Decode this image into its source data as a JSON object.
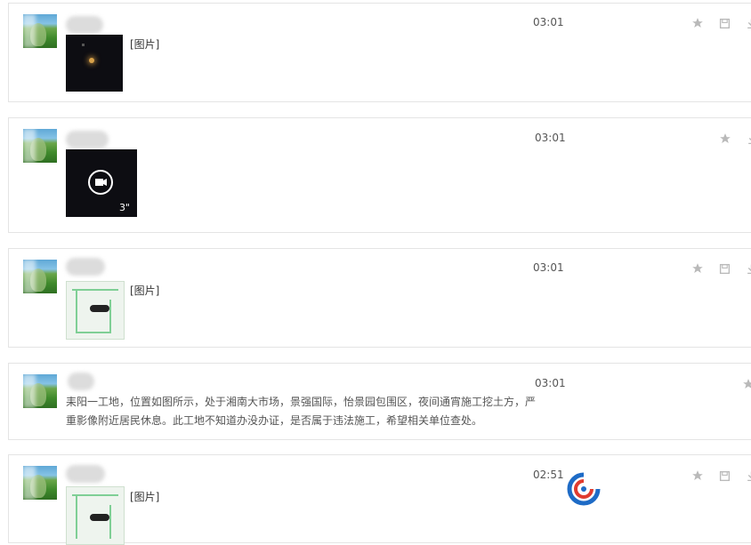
{
  "messages": [
    {
      "type": "image",
      "time": "03:01",
      "pic_label": "[图片]"
    },
    {
      "type": "video",
      "time": "03:01",
      "duration": "3\""
    },
    {
      "type": "image",
      "time": "03:01",
      "pic_label": "[图片]"
    },
    {
      "type": "text",
      "time": "03:01",
      "text_line1": "耒阳一工地，位置如图所示，处于湘南大市场，景强国际，怡景园包围区，夜间通宵施工挖土方，严",
      "text_line2": "重影像附近居民休息。此工地不知道办没办证，是否属于违法施工，希望相关单位查处。"
    },
    {
      "type": "image",
      "time": "02:51",
      "pic_label": "[图片]"
    }
  ],
  "colors": {
    "icon": "#b9b9b9",
    "border": "#e4e4e4",
    "logo_blue": "#1e6bc6",
    "logo_red": "#e03b2f"
  }
}
